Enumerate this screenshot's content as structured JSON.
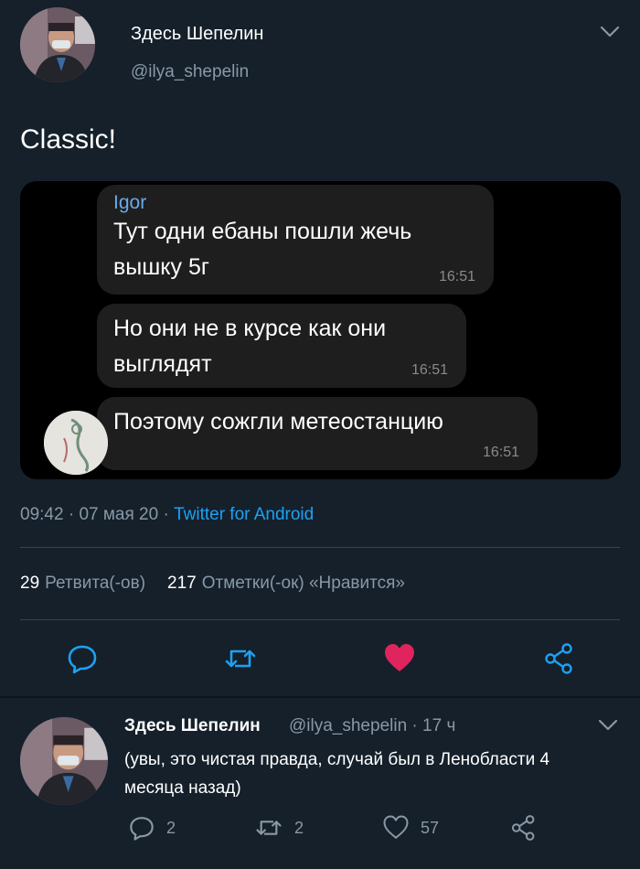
{
  "header": {
    "author_name": "Здесь Шепелин",
    "author_handle": "@ilya_shepelin"
  },
  "tweet": {
    "text": "Classic!",
    "time": "09:42",
    "date": "07 мая 20",
    "source": "Twitter for Android",
    "retweets_count": "29",
    "retweets_label": "Ретвита(-ов)",
    "likes_count": "217",
    "likes_label": "Отметки(-ок) «Нравится»"
  },
  "chat": {
    "messages": [
      {
        "sender": "Igor",
        "line1": "Тут одни ебаны пошли жечь",
        "line2": "вышку 5г",
        "time": "16:51"
      },
      {
        "line1": "Но они не в курсе как они",
        "line2": "выглядят",
        "time": "16:51"
      },
      {
        "line1": "Поэтому сожгли метеостанцию",
        "time": "16:51"
      }
    ]
  },
  "actions": {
    "icons": [
      "reply-icon",
      "retweet-icon",
      "like-icon",
      "share-icon"
    ],
    "like_color": "#e0245e"
  },
  "reply": {
    "author_name": "Здесь Шепелин",
    "meta": "@ilya_shepelin · 17 ч",
    "text": "(увы, это чистая правда, случай был в Ленобласти 4 месяца назад)",
    "reply_count": "2",
    "retweet_count": "2",
    "like_count": "57"
  },
  "colors": {
    "background": "#15202b",
    "muted": "#8899a6",
    "link": "#1da1f2",
    "bubble": "#1e1e1e",
    "sender": "#6aa9e9"
  }
}
